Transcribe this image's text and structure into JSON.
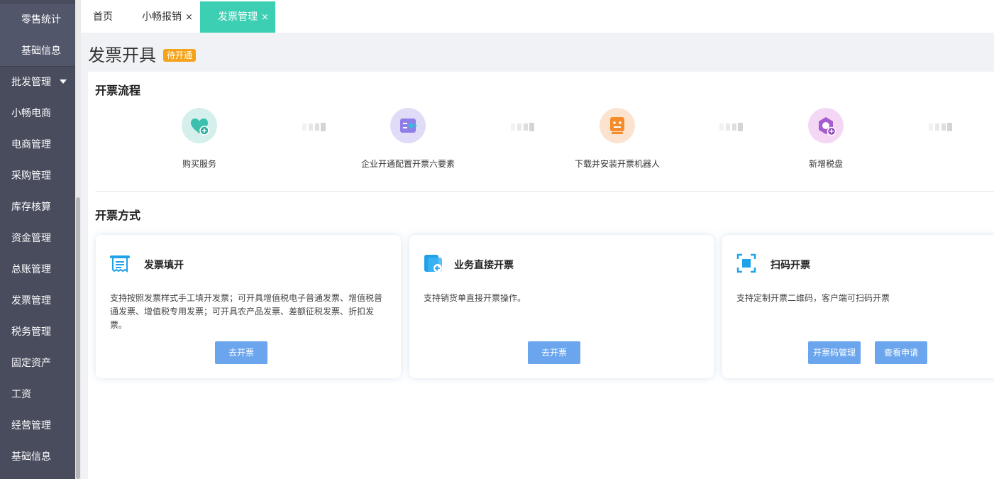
{
  "sidebar": {
    "items": [
      {
        "label": "零售统计"
      },
      {
        "label": "基础信息"
      },
      {
        "label": "批发管理"
      },
      {
        "label": "小畅电商"
      },
      {
        "label": "电商管理"
      },
      {
        "label": "采购管理"
      },
      {
        "label": "库存核算"
      },
      {
        "label": "资金管理"
      },
      {
        "label": "总账管理"
      },
      {
        "label": "发票管理"
      },
      {
        "label": "税务管理"
      },
      {
        "label": "固定资产"
      },
      {
        "label": "工资"
      },
      {
        "label": "经营管理"
      },
      {
        "label": "基础信息"
      }
    ]
  },
  "tabs": [
    {
      "label": "首页",
      "closable": false
    },
    {
      "label": "小畅报销",
      "closable": true
    },
    {
      "label": "发票管理",
      "closable": true,
      "active": true
    }
  ],
  "close_glyph": "×",
  "page": {
    "title": "发票开具",
    "status_badge": "待开通"
  },
  "process": {
    "title": "开票流程",
    "steps": [
      {
        "label": "购买服务",
        "icon": "heart-plus-icon"
      },
      {
        "label": "企业开通配置开票六要素",
        "icon": "config-arrow-icon"
      },
      {
        "label": "下载并安装开票机器人",
        "icon": "robot-icon"
      },
      {
        "label": "新增税盘",
        "icon": "tax-disk-icon"
      }
    ]
  },
  "methods": {
    "title": "开票方式",
    "cards": [
      {
        "title": "发票填开",
        "icon": "invoice-receipt-icon",
        "description": "支持按照发票样式手工填开发票；可开具增值税电子普通发票、增值税普通发票、增值税专用发票；可开具农产品发票、差额征税发票、折扣发票。",
        "buttons": [
          "去开票"
        ]
      },
      {
        "title": "业务直接开票",
        "icon": "business-doc-icon",
        "description": "支持销货单直接开票操作。",
        "buttons": [
          "去开票"
        ]
      },
      {
        "title": "扫码开票",
        "icon": "scan-icon",
        "description": "支持定制开票二维码，客户端可扫码开票",
        "buttons": [
          "开票码管理",
          "查看申请"
        ]
      }
    ]
  },
  "colors": {
    "sidebar_bg": "#484c5d",
    "active_tab": "#3ccfb3",
    "badge": "#f5a31a",
    "button": "#6aa5ee"
  }
}
